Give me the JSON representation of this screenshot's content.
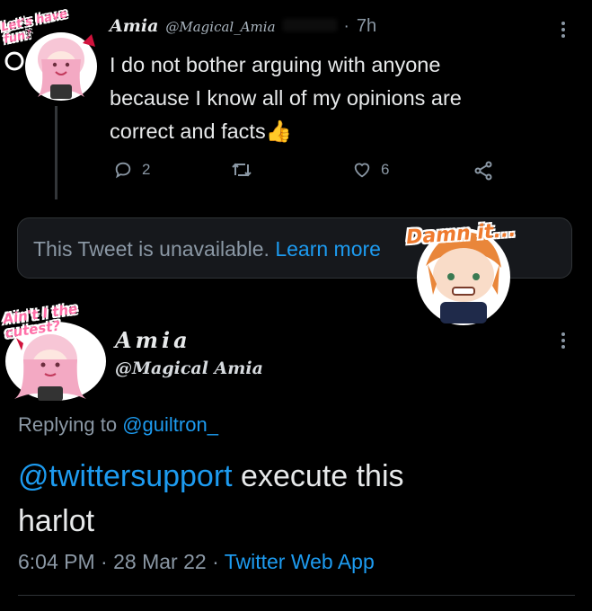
{
  "tweet1": {
    "display_name": "Amia",
    "handle": "@Magical_Amia",
    "time": "7h",
    "text_line1": "I do not bother arguing with anyone",
    "text_line2": "because I know all of my opinions are",
    "text_line3": "correct and facts",
    "emoji": "👍",
    "reply_count": "2",
    "like_count": "6",
    "avatar_sticker_text": "Let's have fun♪",
    "icons": {
      "reply": "reply-icon",
      "retweet": "retweet-icon",
      "like": "heart-icon",
      "share": "share-icon",
      "more": "more-icon"
    }
  },
  "unavailable": {
    "text": "This Tweet is unavailable.",
    "link": "Learn more",
    "sticker_text": "Damn it..."
  },
  "tweet2": {
    "display_name": "Amia",
    "handle": "@Magical Amia",
    "avatar_sticker_text": "Ain't I the cutest?",
    "replying_prefix": "Replying to",
    "replying_to": "@guiltron_",
    "mention": "@twittersupport",
    "body_rest": " execute this",
    "body_line2": "harlot",
    "time": "6:04 PM",
    "date": "28 Mar 22",
    "source": "Twitter Web App",
    "separator": "·"
  },
  "colors": {
    "background": "#000000",
    "text": "#e7e9ea",
    "muted": "#8b98a5",
    "link": "#1d9bf0",
    "card_border": "#2f3336",
    "card_bg": "#16181c"
  }
}
